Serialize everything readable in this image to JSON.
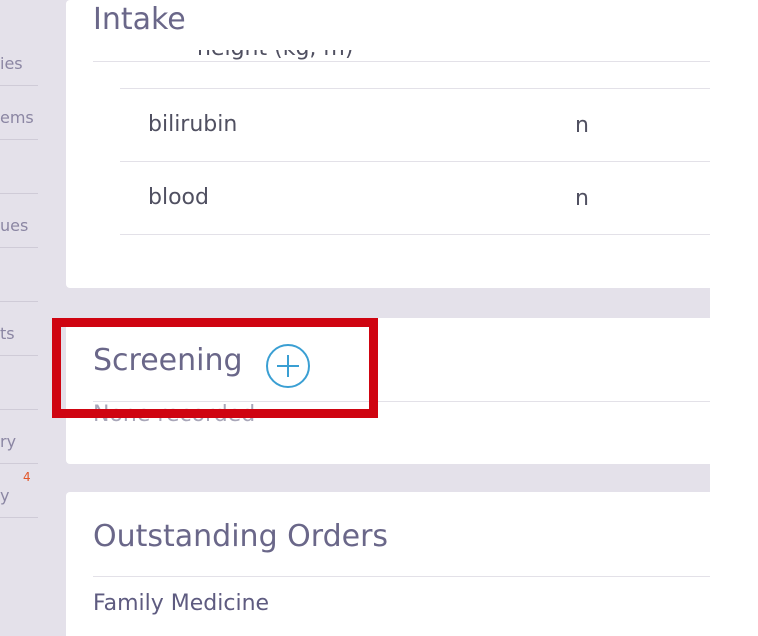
{
  "sidebar": {
    "items": [
      {
        "label": "ies"
      },
      {
        "label": "ems"
      },
      {
        "label": ""
      },
      {
        "label": "ues"
      },
      {
        "label": ""
      },
      {
        "label": "ts"
      },
      {
        "label": ""
      },
      {
        "label": "ry"
      },
      {
        "label": "y",
        "badge": "4"
      }
    ]
  },
  "intake": {
    "title": "Intake",
    "clipped_row": "height (kg, m)",
    "rows": [
      {
        "name": "bilirubin",
        "value": "n"
      },
      {
        "name": "blood",
        "value": "n"
      }
    ]
  },
  "screening": {
    "title": "Screening",
    "add_icon": "plus-circle-icon",
    "empty_text": "None recorded"
  },
  "outstanding_orders": {
    "title": "Outstanding Orders",
    "group": "Family Medicine"
  },
  "colors": {
    "accent": "#3a9fd3",
    "highlight": "#cf0411",
    "badge": "#e2572b"
  }
}
